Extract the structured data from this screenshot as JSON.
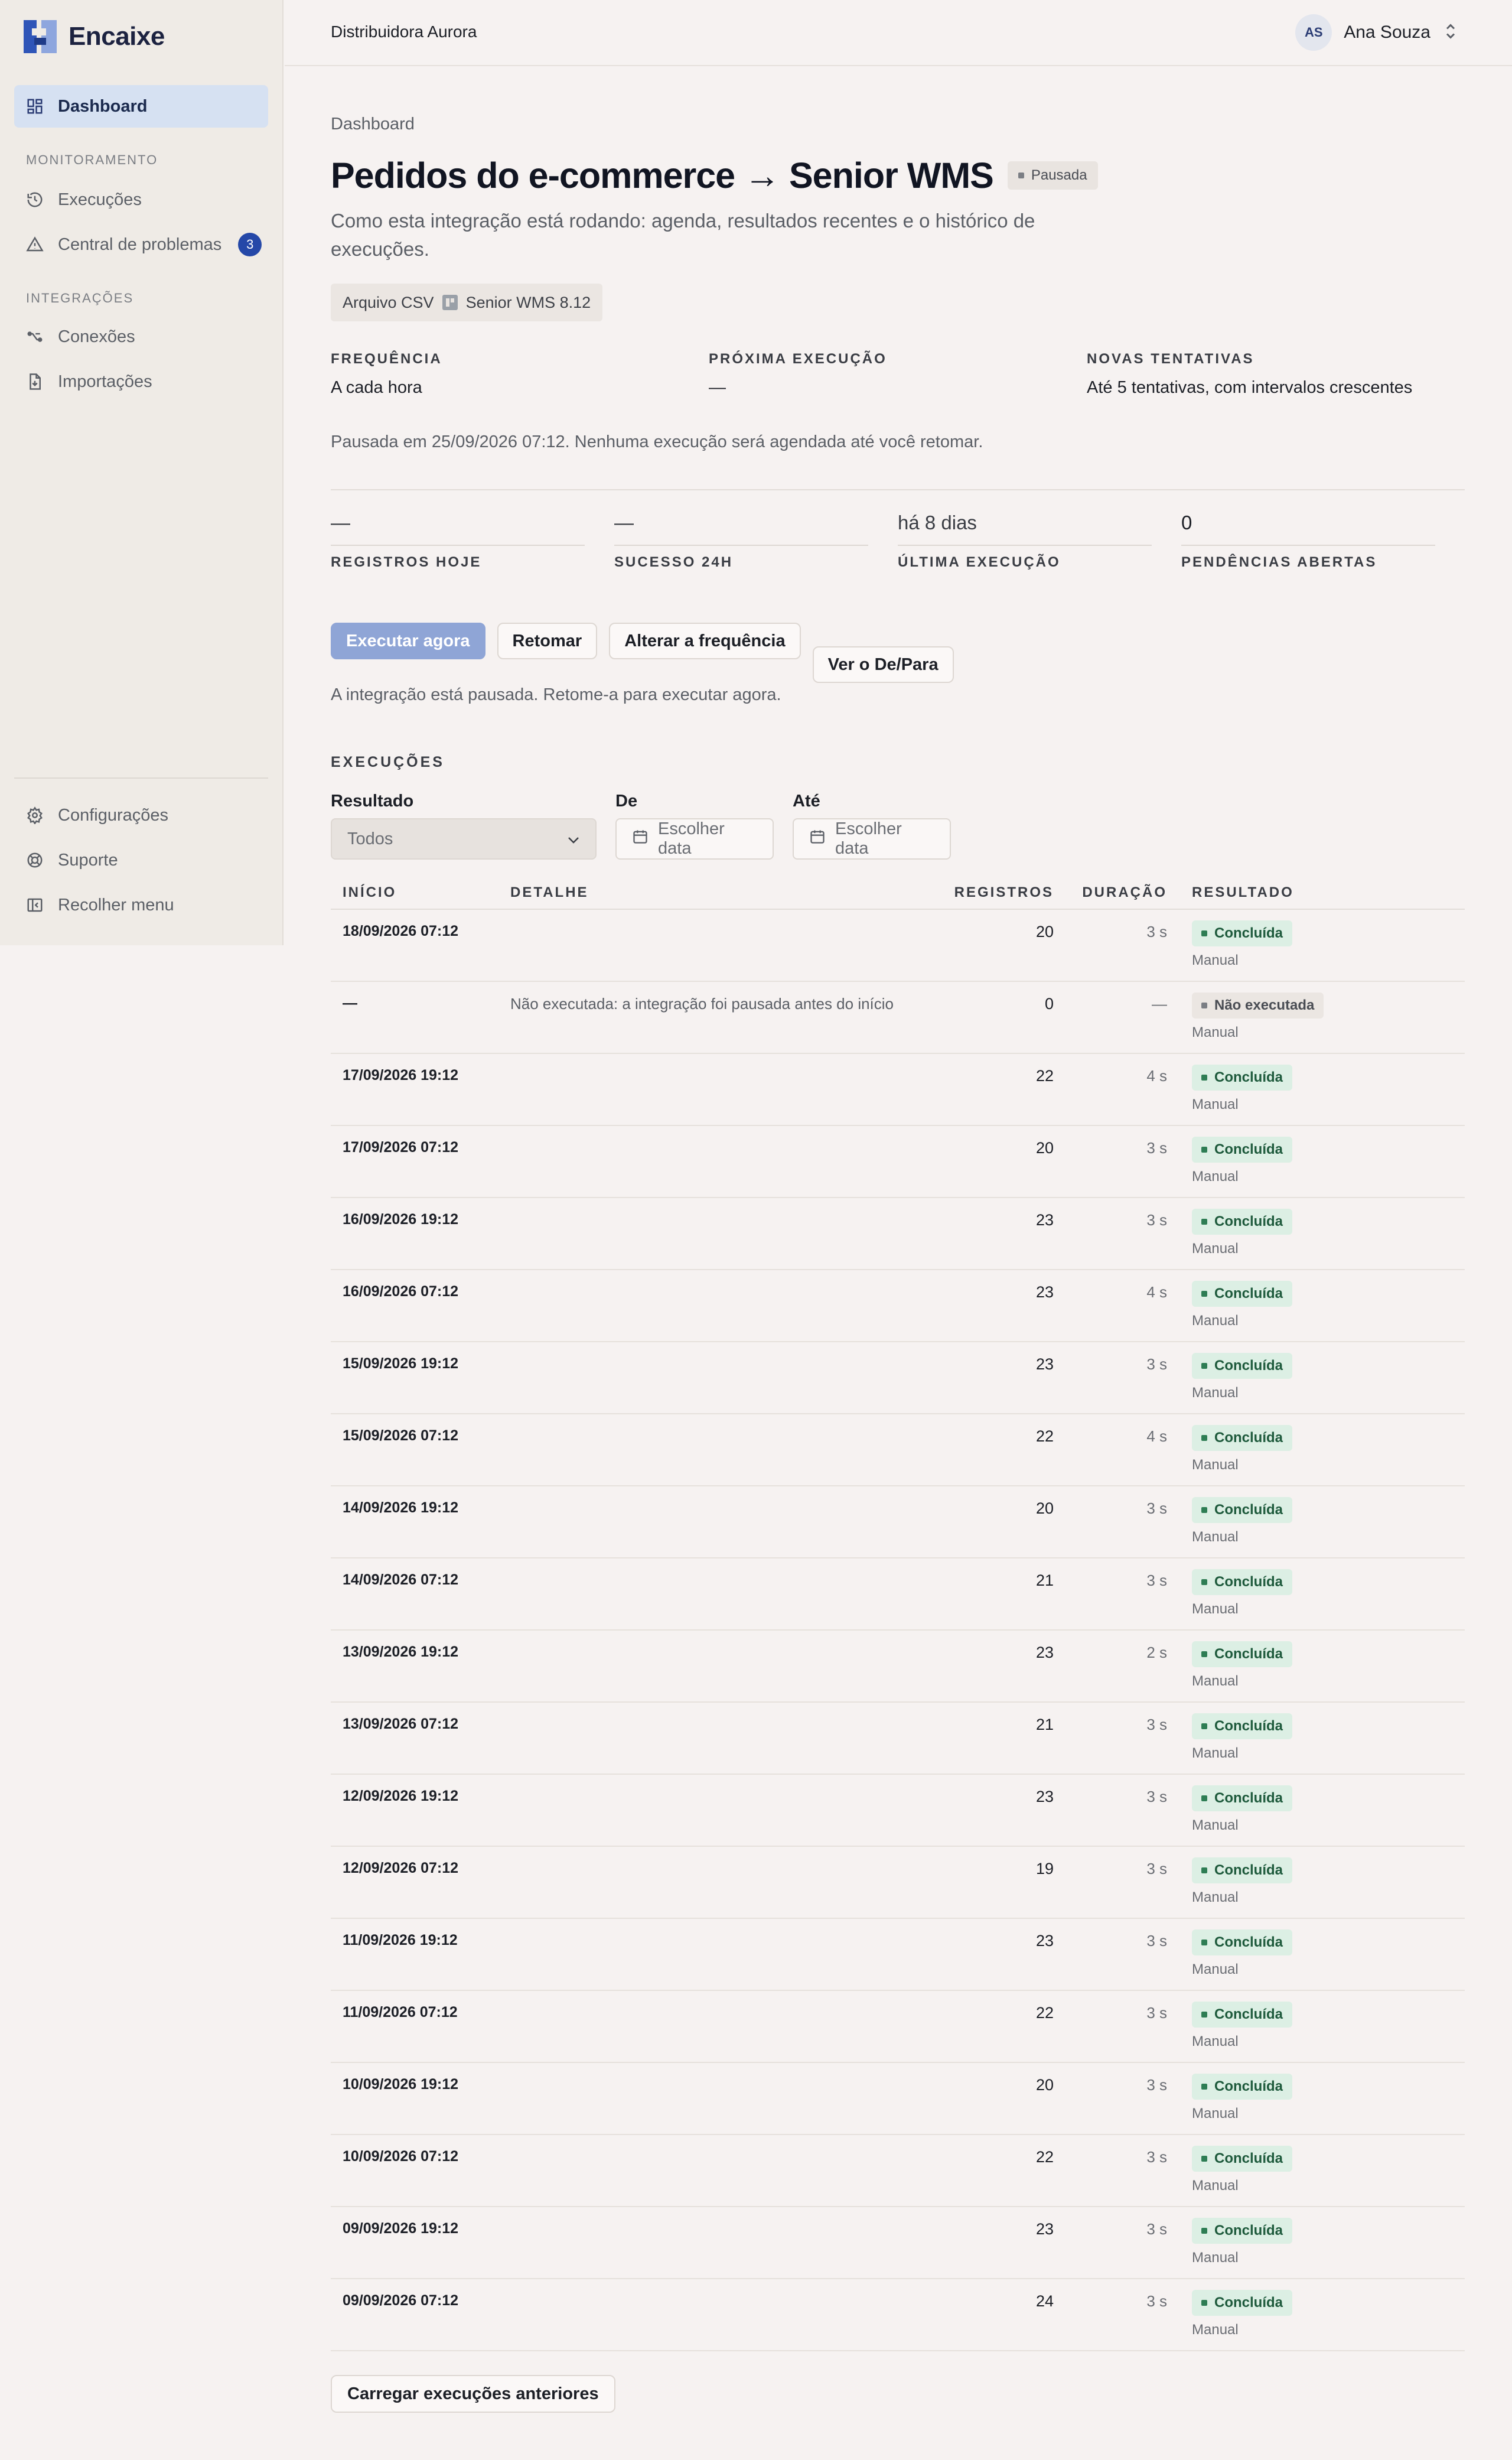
{
  "app": {
    "name": "Encaixe",
    "org": "Distribuidora Aurora",
    "user": {
      "initials": "AS",
      "name": "Ana Souza"
    },
    "brand_color": "#2548a8"
  },
  "sidebar": {
    "dashboard": "Dashboard",
    "section_monitoring": "MONITORAMENTO",
    "executions": "Execuções",
    "problems": "Central de problemas",
    "problems_count": "3",
    "section_integrations": "INTEGRAÇÕES",
    "connections": "Conexões",
    "imports": "Importações",
    "settings": "Configurações",
    "support": "Suporte",
    "collapse": "Recolher menu"
  },
  "page": {
    "breadcrumb": "Dashboard",
    "title": "Pedidos do e-commerce → Senior WMS",
    "status": "Pausada",
    "description": "Como esta integração está rodando: agenda, resultados recentes e o histórico de execuções.",
    "source": "Arquivo CSV",
    "target": "Senior WMS 8.12",
    "meta": [
      {
        "label": "FREQUÊNCIA",
        "value": "A cada hora"
      },
      {
        "label": "PRÓXIMA EXECUÇÃO",
        "value": "—"
      },
      {
        "label": "NOVAS TENTATIVAS",
        "value": "Até 5 tentativas, com intervalos crescentes"
      }
    ],
    "paused_note": "Pausada em 25/09/2026 07:12. Nenhuma execução será agendada até você retomar.",
    "stats": [
      {
        "label": "REGISTROS HOJE",
        "value": "—"
      },
      {
        "label": "SUCESSO 24H",
        "value": "—"
      },
      {
        "label": "ÚLTIMA EXECUÇÃO",
        "value": "há 8 dias"
      },
      {
        "label": "PENDÊNCIAS ABERTAS",
        "value": "0"
      }
    ],
    "actions": {
      "run_now": "Executar agora",
      "resume": "Retomar",
      "change_freq": "Alterar a frequência",
      "view_mapping": "Ver o De/Para",
      "note": "A integração está pausada. Retome-a para executar agora."
    }
  },
  "executions": {
    "heading": "EXECUÇÕES",
    "filters": {
      "result_label": "Resultado",
      "result_value": "Todos",
      "from_label": "De",
      "from_placeholder": "Escolher data",
      "to_label": "Até",
      "to_placeholder": "Escolher data"
    },
    "columns": [
      "INÍCIO",
      "DETALHE",
      "REGISTROS",
      "DURAÇÃO",
      "RESULTADO"
    ],
    "rows": [
      {
        "start": "18/09/2026 07:12",
        "detail": "",
        "records": "20",
        "duration": "3 s",
        "result": "Concluída",
        "status": "ok",
        "trigger": "Manual"
      },
      {
        "start": "—",
        "detail": "Não executada: a integração foi pausada antes do início",
        "records": "0",
        "duration": "—",
        "result": "Não executada",
        "status": "skip",
        "trigger": "Manual"
      },
      {
        "start": "17/09/2026 19:12",
        "detail": "",
        "records": "22",
        "duration": "4 s",
        "result": "Concluída",
        "status": "ok",
        "trigger": "Manual"
      },
      {
        "start": "17/09/2026 07:12",
        "detail": "",
        "records": "20",
        "duration": "3 s",
        "result": "Concluída",
        "status": "ok",
        "trigger": "Manual"
      },
      {
        "start": "16/09/2026 19:12",
        "detail": "",
        "records": "23",
        "duration": "3 s",
        "result": "Concluída",
        "status": "ok",
        "trigger": "Manual"
      },
      {
        "start": "16/09/2026 07:12",
        "detail": "",
        "records": "23",
        "duration": "4 s",
        "result": "Concluída",
        "status": "ok",
        "trigger": "Manual"
      },
      {
        "start": "15/09/2026 19:12",
        "detail": "",
        "records": "23",
        "duration": "3 s",
        "result": "Concluída",
        "status": "ok",
        "trigger": "Manual"
      },
      {
        "start": "15/09/2026 07:12",
        "detail": "",
        "records": "22",
        "duration": "4 s",
        "result": "Concluída",
        "status": "ok",
        "trigger": "Manual"
      },
      {
        "start": "14/09/2026 19:12",
        "detail": "",
        "records": "20",
        "duration": "3 s",
        "result": "Concluída",
        "status": "ok",
        "trigger": "Manual"
      },
      {
        "start": "14/09/2026 07:12",
        "detail": "",
        "records": "21",
        "duration": "3 s",
        "result": "Concluída",
        "status": "ok",
        "trigger": "Manual"
      },
      {
        "start": "13/09/2026 19:12",
        "detail": "",
        "records": "23",
        "duration": "2 s",
        "result": "Concluída",
        "status": "ok",
        "trigger": "Manual"
      },
      {
        "start": "13/09/2026 07:12",
        "detail": "",
        "records": "21",
        "duration": "3 s",
        "result": "Concluída",
        "status": "ok",
        "trigger": "Manual"
      },
      {
        "start": "12/09/2026 19:12",
        "detail": "",
        "records": "23",
        "duration": "3 s",
        "result": "Concluída",
        "status": "ok",
        "trigger": "Manual"
      },
      {
        "start": "12/09/2026 07:12",
        "detail": "",
        "records": "19",
        "duration": "3 s",
        "result": "Concluída",
        "status": "ok",
        "trigger": "Manual"
      },
      {
        "start": "11/09/2026 19:12",
        "detail": "",
        "records": "23",
        "duration": "3 s",
        "result": "Concluída",
        "status": "ok",
        "trigger": "Manual"
      },
      {
        "start": "11/09/2026 07:12",
        "detail": "",
        "records": "22",
        "duration": "3 s",
        "result": "Concluída",
        "status": "ok",
        "trigger": "Manual"
      },
      {
        "start": "10/09/2026 19:12",
        "detail": "",
        "records": "20",
        "duration": "3 s",
        "result": "Concluída",
        "status": "ok",
        "trigger": "Manual"
      },
      {
        "start": "10/09/2026 07:12",
        "detail": "",
        "records": "22",
        "duration": "3 s",
        "result": "Concluída",
        "status": "ok",
        "trigger": "Manual"
      },
      {
        "start": "09/09/2026 19:12",
        "detail": "",
        "records": "23",
        "duration": "3 s",
        "result": "Concluída",
        "status": "ok",
        "trigger": "Manual"
      },
      {
        "start": "09/09/2026 07:12",
        "detail": "",
        "records": "24",
        "duration": "3 s",
        "result": "Concluída",
        "status": "ok",
        "trigger": "Manual"
      }
    ],
    "load_more": "Carregar execuções anteriores"
  }
}
